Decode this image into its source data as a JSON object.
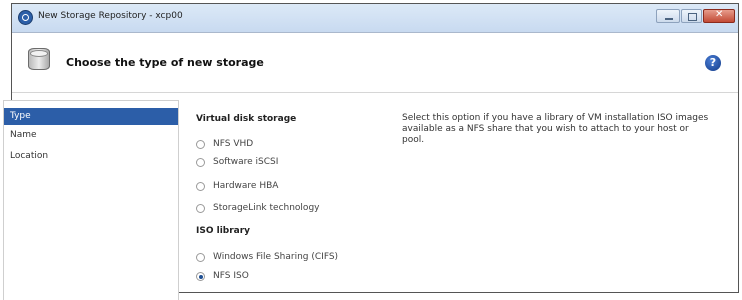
{
  "window": {
    "title": "New Storage Repository - xcp00"
  },
  "header": {
    "title": "Choose the type of new storage",
    "icon": "storage-icon",
    "help_icon": "help-icon",
    "help_glyph": "?"
  },
  "nav": {
    "items": [
      {
        "label": "Type",
        "active": true
      },
      {
        "label": "Name",
        "active": false
      },
      {
        "label": "Location",
        "active": false
      }
    ]
  },
  "content": {
    "virtual_disk": {
      "title": "Virtual disk storage",
      "options": [
        {
          "label": "NFS VHD",
          "checked": false
        },
        {
          "label": "Software iSCSI",
          "checked": false
        },
        {
          "label": "Hardware HBA",
          "checked": false
        },
        {
          "label": "StorageLink technology",
          "checked": false
        }
      ]
    },
    "iso_library": {
      "title": "ISO library",
      "options": [
        {
          "label": "Windows File Sharing (CIFS)",
          "checked": false
        },
        {
          "label": "NFS ISO",
          "checked": true
        }
      ]
    },
    "description": "Select this option if you have a library of VM installation ISO images available as a NFS share that you wish to attach to your host or pool."
  },
  "colors": {
    "nav_selected": "#2c5ea8",
    "titlebar": "#c8daf0",
    "close_button": "#c24a35"
  }
}
